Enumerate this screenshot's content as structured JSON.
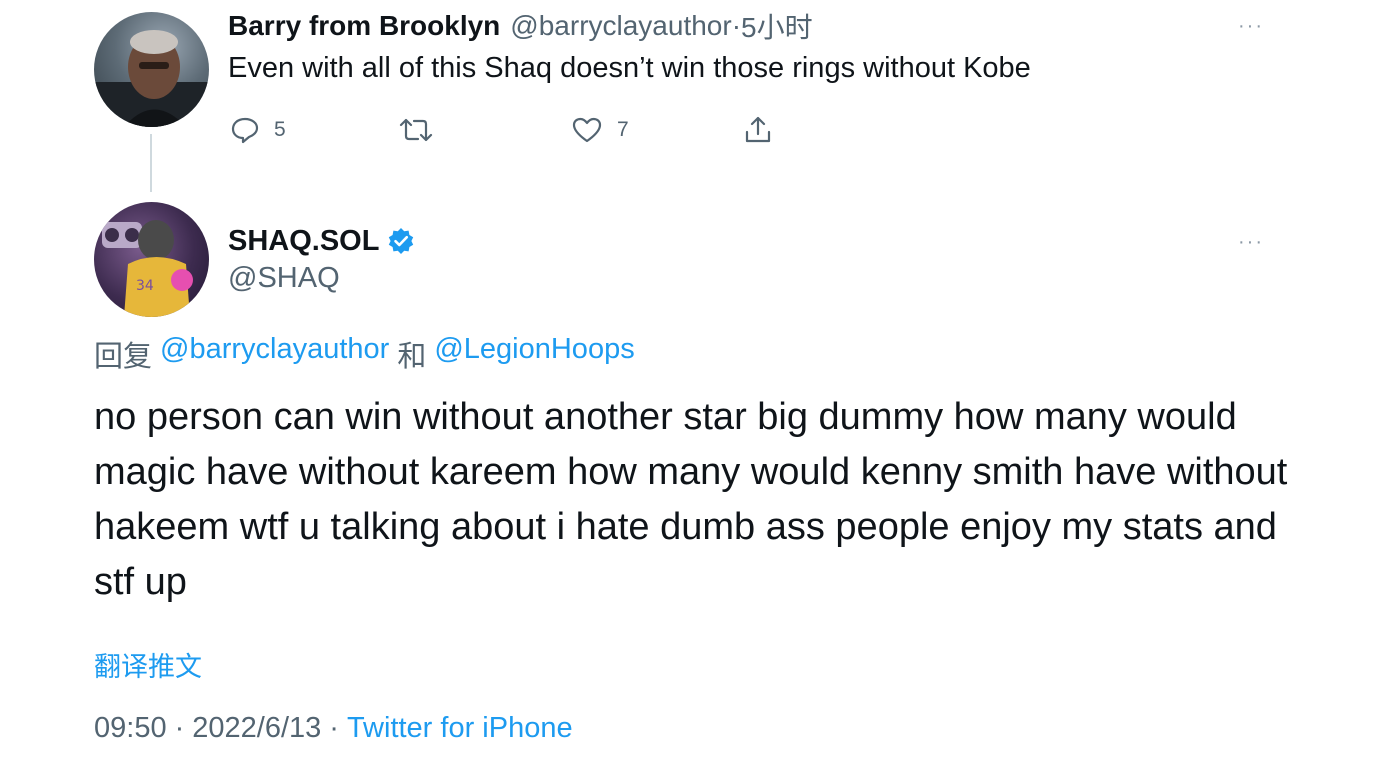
{
  "parent_tweet": {
    "author_name": "Barry from Brooklyn",
    "author_handle": "@barryclayauthor",
    "separator": "·",
    "time_ago": "5小时",
    "text": "Even with all of this Shaq doesn’t win those rings without Kobe",
    "reply_count": "5",
    "retweet_count": "",
    "like_count": "7",
    "more_label": "···"
  },
  "main_tweet": {
    "author_name": "SHAQ.SOL",
    "verified": true,
    "author_handle": "@SHAQ",
    "more_label": "···",
    "reply_prefix": "回复",
    "reply_to_1": "@barryclayauthor",
    "reply_conjunction": "和",
    "reply_to_2": "@LegionHoops",
    "text": "no person can win without another star big dummy how many would magic have without kareem how many would kenny smith have without hakeem wtf u talking about i hate dumb ass people enjoy my stats and stf up",
    "translate_label": "翻译推文",
    "time": "09:50",
    "date": "2022/6/13",
    "source": "Twitter for iPhone",
    "meta_separator": "·"
  },
  "colors": {
    "accent": "#1d9bf0",
    "text": "#0f1419",
    "muted": "#536471",
    "thread_line": "#cfd9de"
  },
  "icons": {
    "reply": "speech-bubble-icon",
    "retweet": "retweet-arrows-icon",
    "like": "heart-icon",
    "share": "share-upload-icon",
    "verified": "verified-badge-icon",
    "more": "more-dots-icon"
  }
}
